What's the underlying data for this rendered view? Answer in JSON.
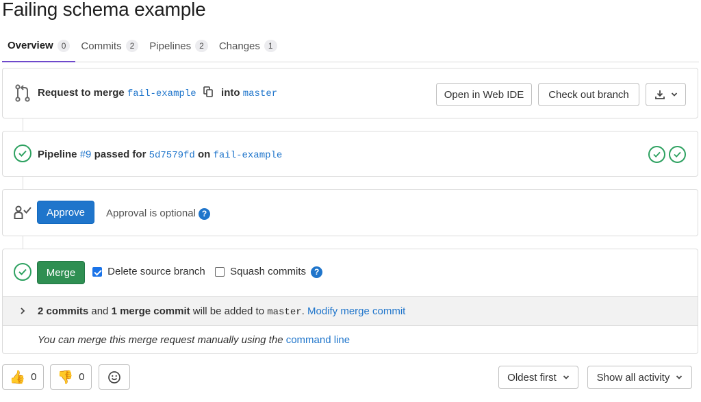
{
  "page_title": "Failing schema example",
  "tabs": [
    {
      "label": "Overview",
      "count": "0"
    },
    {
      "label": "Commits",
      "count": "2"
    },
    {
      "label": "Pipelines",
      "count": "2"
    },
    {
      "label": "Changes",
      "count": "1"
    }
  ],
  "merge_header": {
    "request_text": "Request to merge",
    "source_branch": "fail-example",
    "into_text": "into",
    "target_branch": "master",
    "open_web_ide": "Open in Web IDE",
    "check_out_branch": "Check out branch"
  },
  "pipeline": {
    "label": "Pipeline",
    "id": "#9",
    "passed_for": "passed for",
    "commit": "5d7579fd",
    "on": "on",
    "branch": "fail-example"
  },
  "approval": {
    "approve_button": "Approve",
    "optional_text": "Approval is optional",
    "help": "?"
  },
  "merge": {
    "merge_button": "Merge",
    "delete_source_branch": "Delete source branch",
    "delete_checked": true,
    "squash_commits": "Squash commits",
    "squash_checked": false,
    "help": "?",
    "commits_count": "2 commits",
    "and": "and",
    "merge_commit_count": "1 merge commit",
    "will_be_added": "will be added to",
    "target": "master",
    "period": ".",
    "modify_link": "Modify merge commit",
    "manual_text": "You can merge this merge request manually using the",
    "command_line_link": "command line"
  },
  "reactions": {
    "thumbs_up_count": "0",
    "thumbs_down_count": "0"
  },
  "sort": {
    "order": "Oldest first",
    "filter": "Show all activity"
  },
  "colors": {
    "accent": "#1f75cb",
    "success": "#2f8f52",
    "tab_underline": "#6e49cb"
  }
}
